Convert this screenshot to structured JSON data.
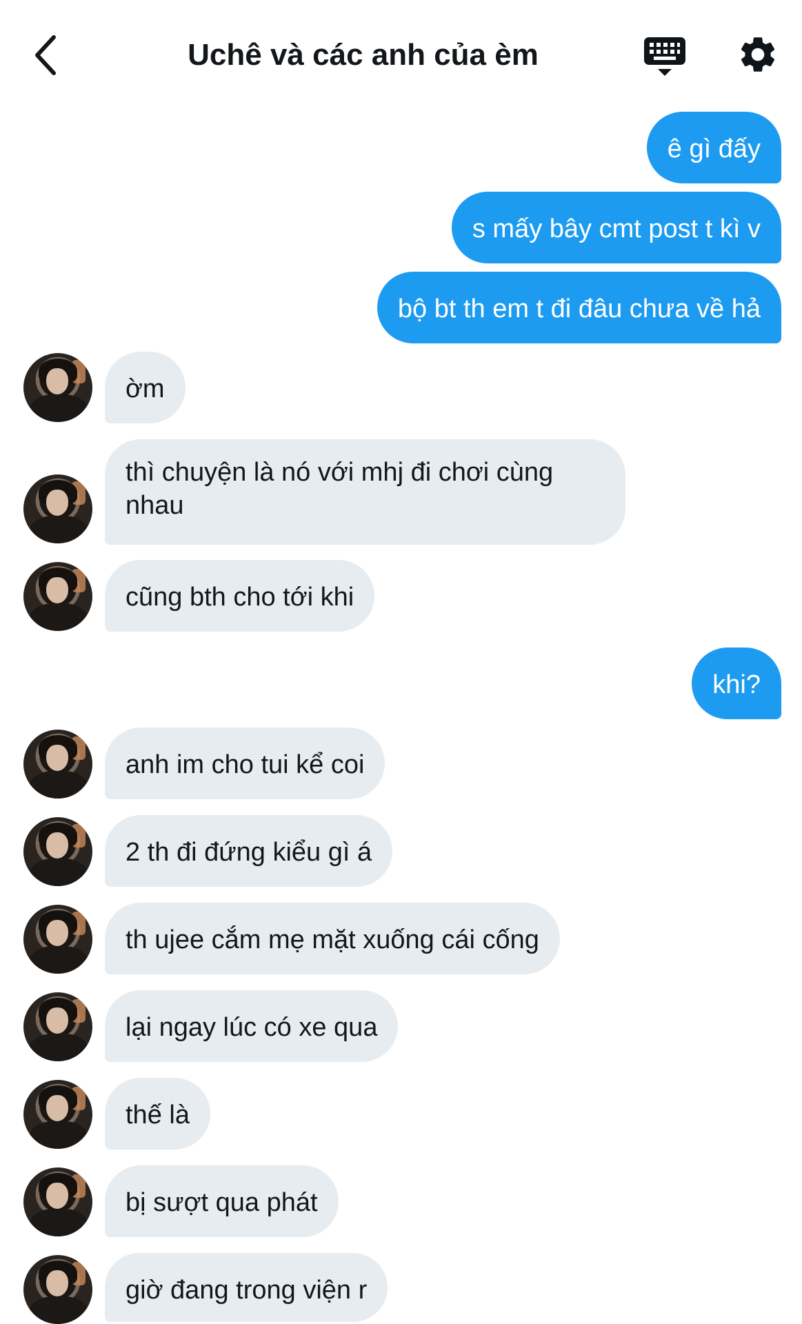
{
  "header": {
    "title": "Uchê và các anh của èm",
    "back_icon": "chevron-left-icon",
    "keyboard_icon": "keyboard-icon",
    "settings_icon": "gear-icon"
  },
  "colors": {
    "outgoing_bubble": "#1d9bf0",
    "incoming_bubble": "#e7ecf0",
    "text": "#14171a"
  },
  "messages": [
    {
      "direction": "out",
      "text": "ê gì đấy"
    },
    {
      "direction": "out",
      "text": "s mấy bây cmt post t kì v"
    },
    {
      "direction": "out",
      "text": "bộ bt th em t đi đâu chưa về hả"
    },
    {
      "direction": "in",
      "text": "ờm"
    },
    {
      "direction": "in",
      "text": "thì chuyện là nó với mhj đi chơi cùng nhau"
    },
    {
      "direction": "in",
      "text": "cũng bth cho tới khi"
    },
    {
      "direction": "out",
      "text": "khi?"
    },
    {
      "direction": "in",
      "text": "anh im cho tui kể coi"
    },
    {
      "direction": "in",
      "text": "2 th đi đứng kiểu gì á"
    },
    {
      "direction": "in",
      "text": "th ujee cắm mẹ mặt xuống cái cống"
    },
    {
      "direction": "in",
      "text": "lại ngay lúc có xe qua"
    },
    {
      "direction": "in",
      "text": "thế là"
    },
    {
      "direction": "in",
      "text": "bị sượt qua phát"
    },
    {
      "direction": "in",
      "text": "giờ đang trong viện r"
    }
  ]
}
